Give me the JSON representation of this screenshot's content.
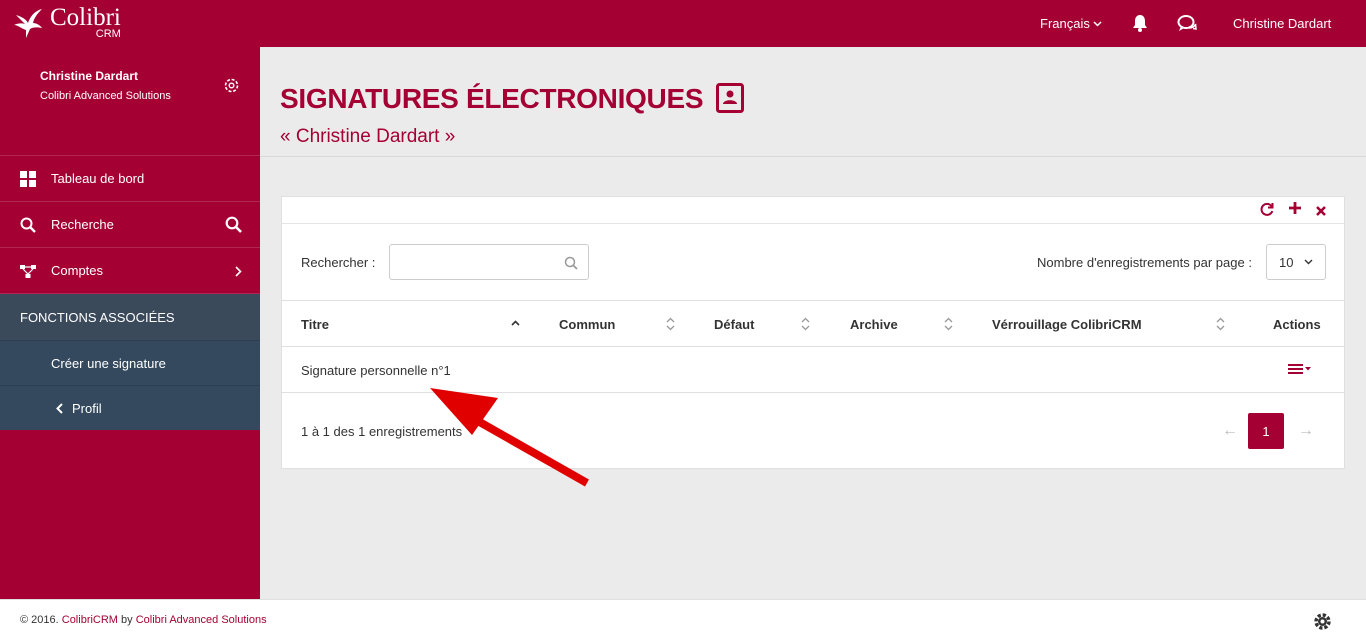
{
  "brand": {
    "name": "Colibri",
    "sub": "CRM"
  },
  "topbar": {
    "language": "Français",
    "user": "Christine Dardart"
  },
  "sidebar": {
    "profile_name": "Christine Dardart",
    "profile_org": "Colibri Advanced Solutions",
    "items": [
      {
        "label": "Tableau de bord",
        "icon": "grid-icon"
      },
      {
        "label": "Recherche",
        "icon": "search-icon"
      },
      {
        "label": "Comptes",
        "icon": "network-icon"
      }
    ],
    "section_title": "FONCTIONS ASSOCIÉES",
    "section_items": [
      {
        "label": "Créer une signature"
      },
      {
        "label": "Profil",
        "icon": "chevron-left-icon"
      }
    ]
  },
  "page": {
    "title": "SIGNATURES ÉLECTRONIQUES",
    "subtitle": "« Christine Dardart »"
  },
  "panel": {
    "search_label": "Rechercher :",
    "search_value": "",
    "per_page_label": "Nombre d'enregistrements par page :",
    "per_page_value": "10",
    "columns": [
      "Titre",
      "Commun",
      "Défaut",
      "Archive",
      "Vérrouillage ColibriCRM",
      "Actions"
    ],
    "rows": [
      {
        "title": "Signature personnelle n°1",
        "commun": "",
        "defaut": "",
        "archive": "",
        "verrouillage": ""
      }
    ],
    "info": "1 à 1 des 1 enregistrements",
    "pagination": {
      "prev": "←",
      "current": "1",
      "next": "→"
    }
  },
  "footer": {
    "prefix": "© 2016. ",
    "product": "ColibriCRM",
    "by": " by ",
    "company": "Colibri Advanced Solutions"
  },
  "colors": {
    "brand": "#a50034",
    "sidebar_dark": "#34495e",
    "annotation_arrow": "#e00000"
  }
}
